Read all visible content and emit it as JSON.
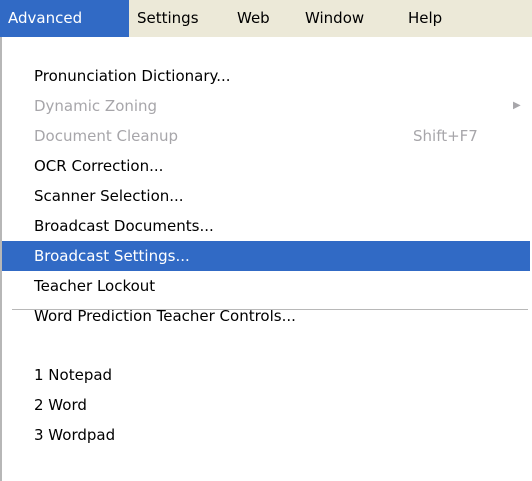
{
  "menubar": {
    "items": [
      {
        "label": "Advanced",
        "active": true
      },
      {
        "label": "Settings",
        "active": false
      },
      {
        "label": "Web",
        "active": false
      },
      {
        "label": "Window",
        "active": false
      },
      {
        "label": "Help",
        "active": false
      }
    ]
  },
  "menu": {
    "items": [
      {
        "label": "Pronunciation Dictionary...",
        "enabled": true
      },
      {
        "label": "Dynamic Zoning",
        "enabled": false,
        "submenu_arrow": "▶"
      },
      {
        "label": "Document Cleanup",
        "enabled": false,
        "shortcut": "Shift+F7"
      },
      {
        "label": "OCR Correction...",
        "enabled": true
      },
      {
        "label": "Scanner Selection...",
        "enabled": true
      },
      {
        "label": "Broadcast Documents...",
        "enabled": true
      },
      {
        "label": "Broadcast Settings...",
        "enabled": true,
        "highlighted": true
      },
      {
        "label": "Teacher Lockout",
        "enabled": true
      },
      {
        "label": "Word Prediction Teacher Controls...",
        "enabled": true
      }
    ],
    "recent_files": [
      {
        "label": "1 Notepad"
      },
      {
        "label": "2 Word"
      },
      {
        "label": "3 Wordpad"
      }
    ]
  },
  "colors": {
    "menubar_bg": "#ece9d8",
    "highlight_bg": "#316ac5",
    "disabled_text": "#a7a6aa"
  }
}
